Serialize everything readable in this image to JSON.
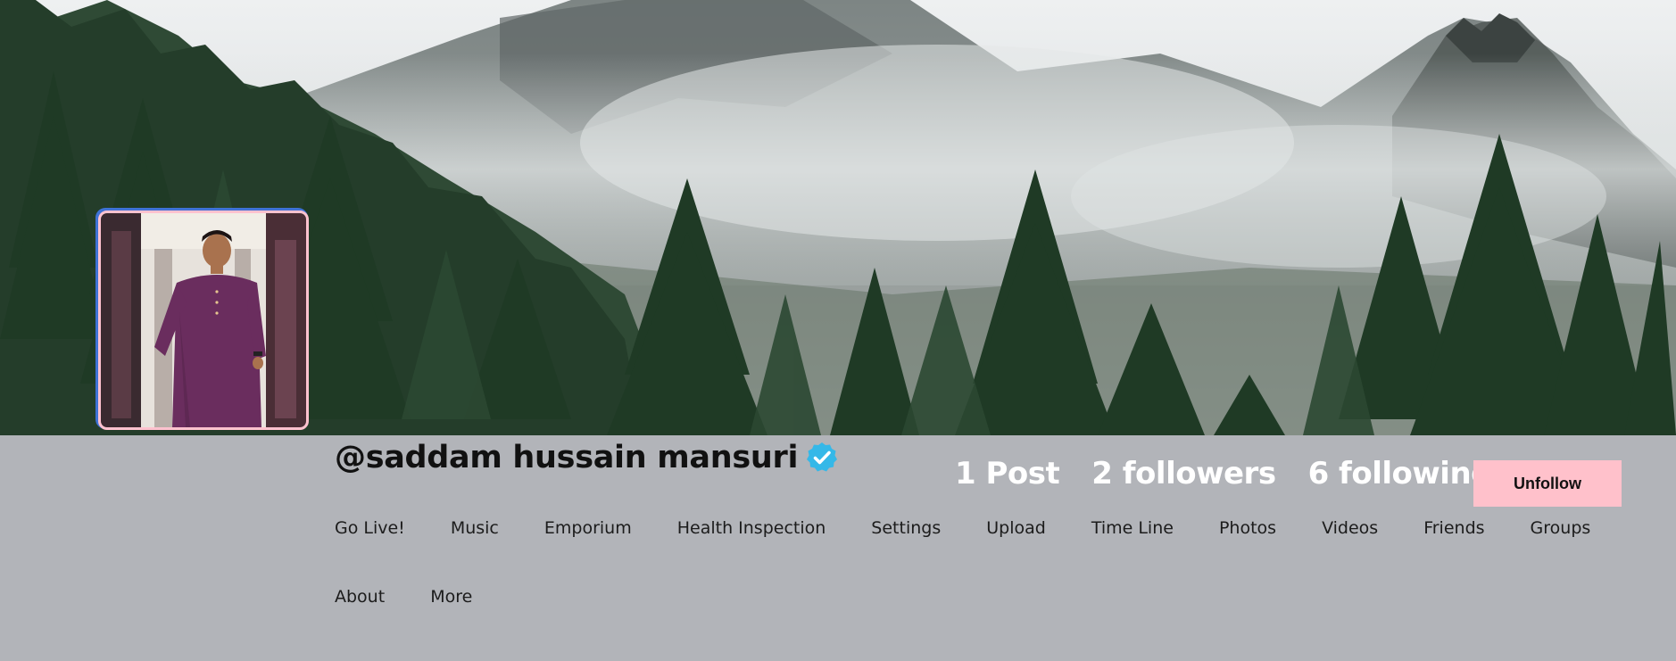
{
  "profile": {
    "username": "@saddam hussain mansuri",
    "verified": true
  },
  "stats": {
    "posts": "1 Post",
    "followers": "2 followers",
    "following": "6 following"
  },
  "actions": {
    "unfollow_label": "Unfollow"
  },
  "nav": {
    "items": [
      "Go Live!",
      "Music",
      "Emporium",
      "Health Inspection",
      "Settings",
      "Upload",
      "Time Line",
      "Photos",
      "Videos",
      "Friends",
      "Groups",
      "About",
      "More"
    ]
  },
  "colors": {
    "header_bg": "#b2b4b9",
    "unfollow_bg": "#ffc1cb",
    "verified_badge": "#35b8e8",
    "avatar_border": "#ffc2cf"
  },
  "icons": {
    "verified": "verified-check-icon"
  }
}
